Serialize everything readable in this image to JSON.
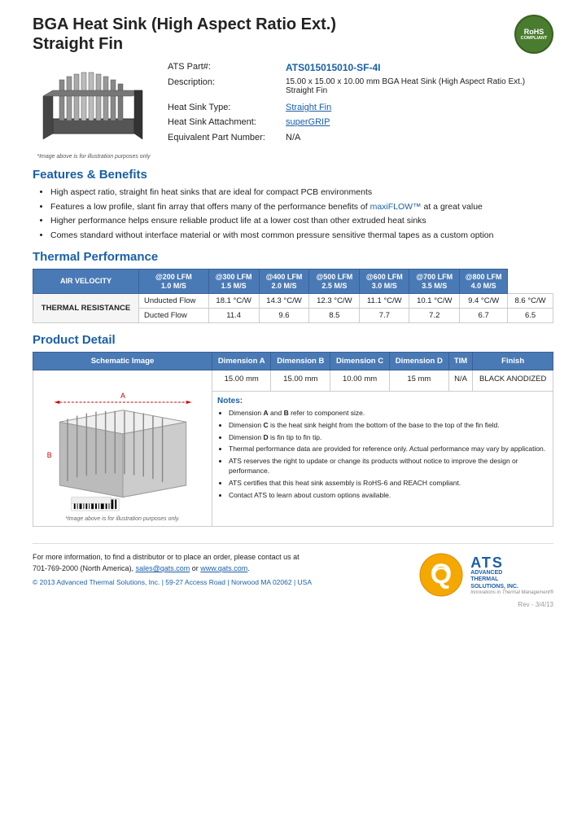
{
  "header": {
    "title_line1": "BGA Heat Sink (High Aspect Ratio Ext.)",
    "title_line2": "Straight Fin",
    "rohs": "RoHS",
    "compliant": "COMPLIANT"
  },
  "product": {
    "part_label": "ATS Part#:",
    "part_number": "ATS015015010-SF-4I",
    "description_label": "Description:",
    "description": "15.00 x 15.00 x 10.00 mm BGA Heat Sink (High Aspect Ratio Ext.) Straight Fin",
    "type_label": "Heat Sink Type:",
    "type_value": "Straight Fin",
    "attachment_label": "Heat Sink Attachment:",
    "attachment_value": "superGRIP",
    "equiv_label": "Equivalent Part Number:",
    "equiv_value": "N/A",
    "image_caption": "*Image above is for illustration purposes only"
  },
  "features": {
    "section_title": "Features & Benefits",
    "items": [
      "High aspect ratio, straight fin heat sinks that are ideal for compact PCB environments",
      "Features a low profile, slant fin array that offers many of the performance benefits of maxiFLOW™ at a great value",
      "Higher performance helps ensure reliable product life at a lower cost than other extruded heat sinks",
      "Comes standard without interface material or with most common pressure sensitive thermal tapes as a custom option"
    ],
    "highlight_maxiflow": "maxiFLOW™"
  },
  "thermal": {
    "section_title": "Thermal Performance",
    "col_headers": [
      "AIR VELOCITY",
      "@200 LFM\n1.0 M/S",
      "@300 LFM\n1.5 M/S",
      "@400 LFM\n2.0 M/S",
      "@500 LFM\n2.5 M/S",
      "@600 LFM\n3.0 M/S",
      "@700 LFM\n3.5 M/S",
      "@800 LFM\n4.0 M/S"
    ],
    "row_label": "THERMAL RESISTANCE",
    "subrows": [
      {
        "label": "Unducted Flow",
        "values": [
          "18.1 °C/W",
          "14.3 °C/W",
          "12.3 °C/W",
          "11.1 °C/W",
          "10.1 °C/W",
          "9.4 °C/W",
          "8.6 °C/W"
        ]
      },
      {
        "label": "Ducted Flow",
        "values": [
          "11.4",
          "9.6",
          "8.5",
          "7.7",
          "7.2",
          "6.7",
          "6.5"
        ]
      }
    ]
  },
  "product_detail": {
    "section_title": "Product Detail",
    "col_headers": [
      "Schematic Image",
      "Dimension A",
      "Dimension B",
      "Dimension C",
      "Dimension D",
      "TIM",
      "Finish"
    ],
    "dim_values": [
      "15.00 mm",
      "15.00 mm",
      "10.00 mm",
      "15 mm",
      "N/A",
      "BLACK ANODIZED"
    ],
    "schematic_caption": "*Image above is for illustration purposes only.",
    "notes_label": "Notes:",
    "notes": [
      "Dimension A and B refer to component size.",
      "Dimension C is the heat sink height from the bottom of the base to the top of the fin field.",
      "Dimension D is fin tip to fin tip.",
      "Thermal performance data are provided for reference only. Actual performance may vary by application.",
      "ATS reserves the right to update or change its products without notice to improve the design or performance.",
      "ATS certifies that this heat sink assembly is RoHS-6 and REACH compliant.",
      "Contact ATS to learn about custom options available."
    ]
  },
  "footer": {
    "contact_text": "For more information, to find a distributor or to place an order, please contact us at\n701-769-2000 (North America),",
    "email": "sales@qats.com",
    "or_text": " or ",
    "website": "www.qats.com",
    "copyright": "© 2013 Advanced Thermal Solutions, Inc. | 59-27 Access Road | Norwood MA  02062 | USA",
    "ats_name": "ATS",
    "ats_full": "ADVANCED\nTHERMAL\nSOLUTIONS, INC.",
    "tagline": "Innovations in Thermal Management®",
    "page_number": "Rev - 3/4/13"
  }
}
